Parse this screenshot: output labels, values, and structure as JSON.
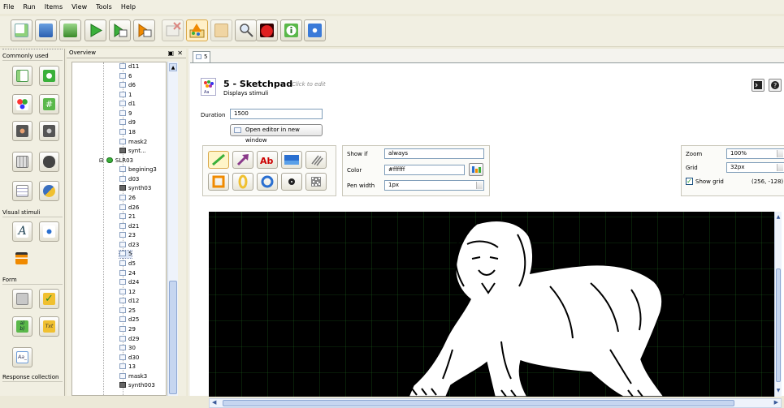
{
  "menu": [
    "File",
    "Run",
    "Items",
    "View",
    "Tools",
    "Help"
  ],
  "toolbar_icons": [
    "new-file-icon",
    "open-file-icon",
    "save-file-icon",
    "run-icon",
    "run-window-icon",
    "quick-run-icon",
    "close-icon",
    "sketchpad-icon",
    "zoom-icon",
    "search-icon",
    "ladybug-icon",
    "info-icon",
    "plugin-icon"
  ],
  "left": {
    "common_header": "Commonly used",
    "visual_header": "Visual stimuli",
    "form_header": "Form",
    "response_header": "Response collection",
    "multichoice_label": "a)\nb)",
    "text_label": "Txt",
    "aa_label": "Aa_"
  },
  "overview": {
    "title": "Overview",
    "rows": [
      {
        "label": "d11",
        "indent": 2,
        "type": "sketch"
      },
      {
        "label": "6",
        "indent": 2,
        "type": "sketch"
      },
      {
        "label": "d6",
        "indent": 2,
        "type": "sketch"
      },
      {
        "label": "1",
        "indent": 2,
        "type": "sketch"
      },
      {
        "label": "d1",
        "indent": 2,
        "type": "sketch"
      },
      {
        "label": "9",
        "indent": 2,
        "type": "sketch"
      },
      {
        "label": "d9",
        "indent": 2,
        "type": "sketch"
      },
      {
        "label": "18",
        "indent": 2,
        "type": "sketch"
      },
      {
        "label": "mask2",
        "indent": 2,
        "type": "sketch"
      },
      {
        "label": "synt...",
        "indent": 2,
        "type": "synth"
      },
      {
        "label": "SLR03",
        "indent": 1,
        "type": "sequence"
      },
      {
        "label": "begining3",
        "indent": 2,
        "type": "sketch"
      },
      {
        "label": "d03",
        "indent": 2,
        "type": "sketch"
      },
      {
        "label": "synth03",
        "indent": 2,
        "type": "synth"
      },
      {
        "label": "26",
        "indent": 2,
        "type": "sketch"
      },
      {
        "label": "d26",
        "indent": 2,
        "type": "sketch"
      },
      {
        "label": "21",
        "indent": 2,
        "type": "sketch"
      },
      {
        "label": "d21",
        "indent": 2,
        "type": "sketch"
      },
      {
        "label": "23",
        "indent": 2,
        "type": "sketch"
      },
      {
        "label": "d23",
        "indent": 2,
        "type": "sketch"
      },
      {
        "label": "5",
        "indent": 2,
        "type": "sketch",
        "selected": true
      },
      {
        "label": "d5",
        "indent": 2,
        "type": "sketch"
      },
      {
        "label": "24",
        "indent": 2,
        "type": "sketch"
      },
      {
        "label": "d24",
        "indent": 2,
        "type": "sketch"
      },
      {
        "label": "12",
        "indent": 2,
        "type": "sketch"
      },
      {
        "label": "d12",
        "indent": 2,
        "type": "sketch"
      },
      {
        "label": "25",
        "indent": 2,
        "type": "sketch"
      },
      {
        "label": "d25",
        "indent": 2,
        "type": "sketch"
      },
      {
        "label": "29",
        "indent": 2,
        "type": "sketch"
      },
      {
        "label": "d29",
        "indent": 2,
        "type": "sketch"
      },
      {
        "label": "30",
        "indent": 2,
        "type": "sketch"
      },
      {
        "label": "d30",
        "indent": 2,
        "type": "sketch"
      },
      {
        "label": "13",
        "indent": 2,
        "type": "sketch"
      },
      {
        "label": "mask3",
        "indent": 2,
        "type": "sketch"
      },
      {
        "label": "synth003",
        "indent": 2,
        "type": "synth"
      }
    ]
  },
  "tab": {
    "label": "5"
  },
  "item": {
    "title": "5 - Sketchpad",
    "click_to_edit": "Click to edit",
    "description": "Displays stimuli",
    "duration_label": "Duration",
    "duration_value": "1500",
    "open_editor": "Open editor in new window"
  },
  "properties": {
    "show_if_label": "Show if",
    "show_if_value": "always",
    "color_label": "Color",
    "color_value": "#ffffff",
    "pen_width_label": "Pen width",
    "pen_width_value": "1px"
  },
  "view": {
    "zoom_label": "Zoom",
    "zoom_value": "100%",
    "grid_label": "Grid",
    "grid_value": "32px",
    "show_grid_label": "Show grid",
    "coords": "(256, -128)"
  },
  "colors": {
    "canvas_bg": "#000000",
    "grid": "#1e6b1e",
    "accent_green": "#5cb85c",
    "accent_orange": "#f08a00",
    "accent_blue": "#2a6fd0"
  }
}
